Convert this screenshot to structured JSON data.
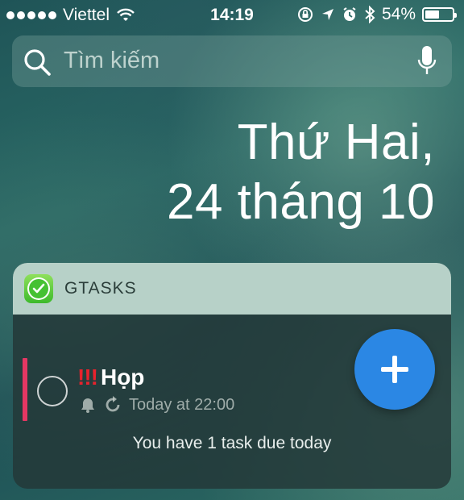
{
  "status_bar": {
    "carrier": "Viettel",
    "time": "14:19",
    "battery": "54%",
    "battery_level": 0.54,
    "icons": [
      "signal-dots-icon",
      "wifi-icon",
      "orientation-lock-icon",
      "location-arrow-icon",
      "alarm-icon",
      "bluetooth-icon",
      "battery-icon"
    ]
  },
  "search": {
    "placeholder": "Tìm kiếm",
    "icons": [
      "search-icon",
      "mic-icon"
    ]
  },
  "date": {
    "line1": "Thứ Hai,",
    "line2": "24 tháng 10"
  },
  "widget": {
    "title": "GTASKS",
    "app_icon": "gtasks-check-icon",
    "task": {
      "priority": "!!!",
      "title": "Họp",
      "due": "Today at 22:00",
      "icons": [
        "bell-icon",
        "repeat-icon"
      ],
      "priority_color": "#e53763"
    },
    "summary": "You have 1 task due today",
    "fab_icon": "plus-icon",
    "fab_color": "#2b87e4"
  }
}
